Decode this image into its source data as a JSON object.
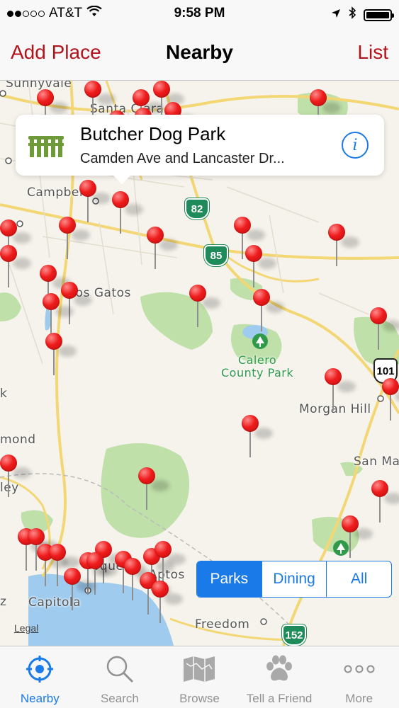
{
  "status_bar": {
    "carrier": "AT&T",
    "signal_bars_filled": 2,
    "signal_bars_total": 5,
    "time": "9:58 PM",
    "icons": [
      "wifi-icon",
      "location-arrow-icon",
      "bluetooth-icon",
      "battery-icon"
    ]
  },
  "nav": {
    "left_label": "Add Place",
    "title": "Nearby",
    "right_label": "List",
    "accent": "#b3141c"
  },
  "map": {
    "labels": {
      "sunnyvale": "Sunnyvale",
      "santa_clara": "Santa Clara",
      "campbell": "Campbell",
      "los_gatos": "Los Gatos",
      "morgan_hill": "Morgan Hill",
      "san_martin": "San Ma",
      "k": "k",
      "richmond": "mond",
      "ley": "ley",
      "capitola": "Capitola",
      "aptos": "Aptos",
      "soquel": "oque",
      "freedom": "Freedom",
      "z": "z"
    },
    "park_label": "Calero\nCounty Park",
    "park_label_line1": "Calero",
    "park_label_line2": "County Park",
    "highways": {
      "h82": "82",
      "h85": "85",
      "h101": "101",
      "h152": "152"
    },
    "legal": "Legal"
  },
  "callout": {
    "title": "Butcher Dog Park",
    "subtitle": "Camden Ave and Lancaster Dr...",
    "icon": "park-fence-icon",
    "info_icon": "info-icon",
    "info_glyph": "i"
  },
  "filter": {
    "options": [
      "Parks",
      "Dining",
      "All"
    ],
    "selected": "Parks",
    "accent": "#1a7ae8"
  },
  "tabs": [
    {
      "label": "Nearby",
      "icon": "crosshair-icon",
      "active": true
    },
    {
      "label": "Search",
      "icon": "magnifier-icon",
      "active": false
    },
    {
      "label": "Browse",
      "icon": "map-icon",
      "active": false
    },
    {
      "label": "Tell a Friend",
      "icon": "paw-icon",
      "active": false
    },
    {
      "label": "More",
      "icon": "more-dots-icon",
      "active": false
    }
  ]
}
